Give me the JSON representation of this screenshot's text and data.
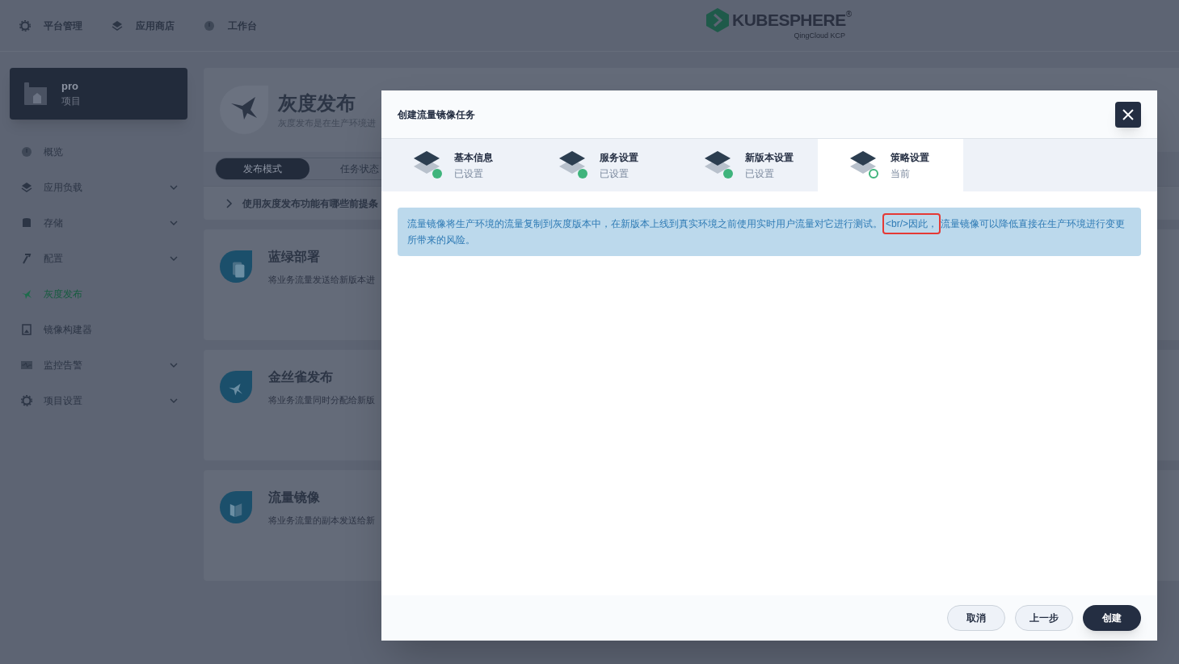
{
  "top_nav": [
    {
      "label": "平台管理"
    },
    {
      "label": "应用商店"
    },
    {
      "label": "工作台"
    }
  ],
  "logo": {
    "name": "KUBESPHERE",
    "mark": "®",
    "subtitle": "QingCloud KCP"
  },
  "project": {
    "name": "pro",
    "type": "项目"
  },
  "sidebar": {
    "items": [
      {
        "label": "概览",
        "expandable": false,
        "selected": false
      },
      {
        "label": "应用负载",
        "expandable": true,
        "selected": false
      },
      {
        "label": "存储",
        "expandable": true,
        "selected": false
      },
      {
        "label": "配置",
        "expandable": true,
        "selected": false
      },
      {
        "label": "灰度发布",
        "expandable": false,
        "selected": true
      },
      {
        "label": "镜像构建器",
        "expandable": false,
        "selected": false
      },
      {
        "label": "监控告警",
        "expandable": true,
        "selected": false
      },
      {
        "label": "项目设置",
        "expandable": true,
        "selected": false
      }
    ]
  },
  "page": {
    "title": "灰度发布",
    "description": "灰度发布是在生产环境进",
    "tabs": [
      {
        "label": "发布模式",
        "selected": true
      },
      {
        "label": "任务状态",
        "selected": false
      }
    ],
    "faq": "使用灰度发布功能有哪些前提条",
    "cards": [
      {
        "title": "蓝绿部署",
        "description": "将业务流量发送给新版本进"
      },
      {
        "title": "金丝雀发布",
        "description": "将业务流量同时分配给新版"
      },
      {
        "title": "流量镜像",
        "description": "将业务流量的副本发送给新"
      }
    ]
  },
  "modal": {
    "title": "创建流量镜像任务",
    "steps": [
      {
        "title": "基本信息",
        "status_text": "已设置",
        "completed": true,
        "selected": false
      },
      {
        "title": "服务设置",
        "status_text": "已设置",
        "completed": true,
        "selected": false
      },
      {
        "title": "新版本设置",
        "status_text": "已设置",
        "completed": true,
        "selected": false
      },
      {
        "title": "策略设置",
        "status_text": "当前",
        "completed": false,
        "selected": true
      }
    ],
    "notice": [
      {
        "text": "流量镜像将生产环境的流量复制到灰度版本中，在新版本上线到真实环境之前使用实时用户流量对它进行测试。",
        "highlighted": false
      },
      {
        "text": "<br/>因此，",
        "highlighted": true
      },
      {
        "text": "流量镜像可以降低直接在生产环境进行变更所带来的风险。",
        "highlighted": false
      }
    ],
    "buttons": [
      {
        "label": "取消",
        "kind": "secondary"
      },
      {
        "label": "上一步",
        "kind": "secondary"
      },
      {
        "label": "创建",
        "kind": "primary"
      }
    ]
  }
}
